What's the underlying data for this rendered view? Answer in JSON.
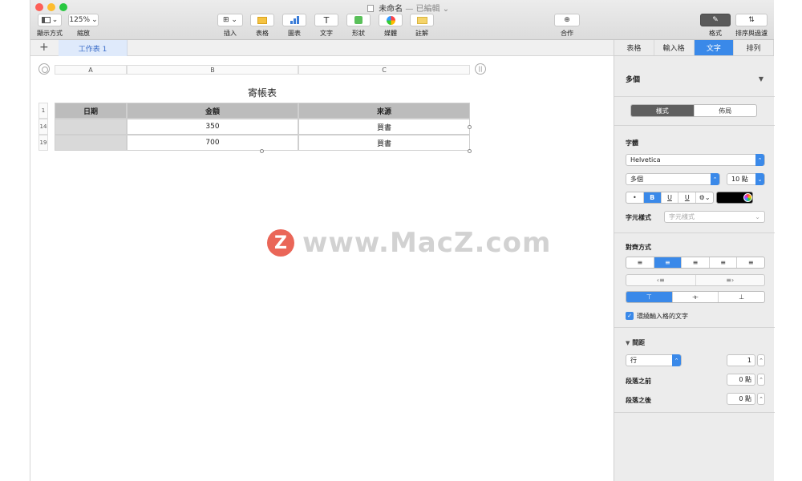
{
  "window": {
    "title": "未命名",
    "title_status": "— 已編輯",
    "title_chevron": "⌄"
  },
  "toolbar": {
    "view_label": "顯示方式",
    "view_icon": "sidebar-icon",
    "zoom_value": "125%",
    "zoom_label": "縮放",
    "insert_label": "插入",
    "table_label": "表格",
    "chart_label": "圖表",
    "text_label": "文字",
    "shape_label": "形狀",
    "media_label": "媒體",
    "comment_label": "註解",
    "collaborate_label": "合作",
    "format_label": "格式",
    "sort_filter_label": "排序與過濾",
    "text_icon_glyph": "T",
    "sort_icon_glyph": "⇅",
    "format_icon_glyph": "✎",
    "insert_icon_glyph": "⊞ ⌄",
    "collab_icon_glyph": "⊕",
    "dropdown_chevron": "⌄"
  },
  "sheets": {
    "add_label": "+",
    "tabs": [
      {
        "label": "工作表 1"
      }
    ]
  },
  "table": {
    "title": "寄帳表",
    "columns": [
      "A",
      "B",
      "C"
    ],
    "end_handle": "||",
    "headers": [
      "日期",
      "金額",
      "來源"
    ],
    "row_numbers": [
      "1",
      "14",
      "19"
    ],
    "rows": [
      {
        "date": "",
        "amount": "350",
        "source": "買書"
      },
      {
        "date": "",
        "amount": "700",
        "source": "買書"
      }
    ]
  },
  "watermark": {
    "logo": "Z",
    "text": "www.MacZ.com"
  },
  "inspector": {
    "tabs": [
      "表格",
      "輸入格",
      "文字",
      "排列"
    ],
    "active_tab": "文字",
    "paragraph_style": "多個",
    "paragraph_style_chevron": "▼",
    "segment": [
      "樣式",
      "佈局"
    ],
    "font_section": "字體",
    "font_name": "Helvetica",
    "font_style": "多個",
    "font_size": "10 點",
    "stepper_glyph": "⌃",
    "dropdown_glyph": "⌄",
    "style_buttons": [
      "•",
      "B",
      "U",
      "U",
      "⚙⌄"
    ],
    "char_style_label": "字元樣式",
    "char_style_value": "字元樣式",
    "alignment_section": "對齊方式",
    "h_align": [
      "≡",
      "≡",
      "≡",
      "≡",
      "≡"
    ],
    "indent": [
      "‹≡",
      "≡›"
    ],
    "v_align": [
      "⊤",
      "⟛",
      "⊥"
    ],
    "wrap_text_checked": true,
    "check_mark": "✓",
    "wrap_text_label": "環繞輸入格的文字",
    "spacing_disclosure": "▼",
    "spacing_section": "間距",
    "line_spacing_mode": "行",
    "line_spacing_value": "1",
    "before_paragraph_label": "段落之前",
    "before_paragraph_value": "0 點",
    "after_paragraph_label": "段落之後",
    "after_paragraph_value": "0 點"
  },
  "colors": {
    "accent": "#3a89e9",
    "header_fill": "#bcbcbc",
    "row_header_fill": "#d9d9d9"
  }
}
